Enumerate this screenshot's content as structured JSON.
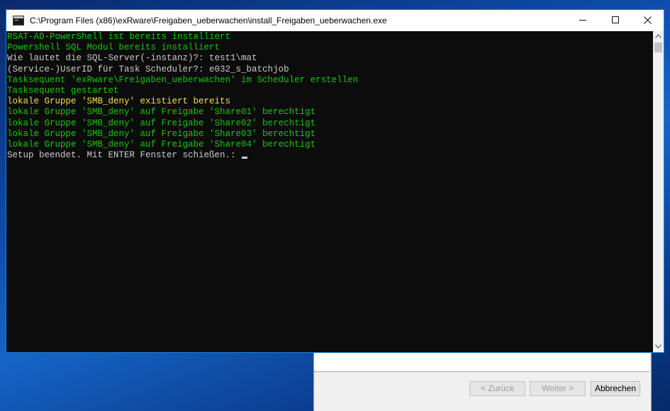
{
  "window": {
    "title": "C:\\Program Files (x86)\\exRware\\Freigaben_ueberwachen\\install_Freigaben_ueberwachen.exe",
    "icon": "console-icon",
    "controls": {
      "minimize": "minimize-icon",
      "maximize": "maximize-icon",
      "close": "close-icon"
    }
  },
  "console": {
    "colors": {
      "green": "#16c60c",
      "gray": "#cccccc",
      "yellow": "#f0e050",
      "background": "#0c0c0c"
    },
    "lines": [
      {
        "text": "RSAT-AD-PowerShell ist bereits installiert",
        "color": "green"
      },
      {
        "text": "Powershell SQL Modul bereits installiert",
        "color": "green"
      },
      {
        "text": "Wie lautet die SQL-Server(-instanz)?: test1\\mat",
        "color": "gray"
      },
      {
        "text": "(Service-)UserID für Task Scheduler?: e032_s_batchjob",
        "color": "gray"
      },
      {
        "text": "Tasksequent 'exRware\\Freigaben_ueberwachen' im Scheduler erstellen",
        "color": "green"
      },
      {
        "text": "Tasksequent gestartet",
        "color": "green"
      },
      {
        "text": "lokale Gruppe 'SMB_deny' existiert bereits",
        "color": "yellow"
      },
      {
        "text": "lokale Gruppe 'SMB_deny' auf Freigabe 'Share01' berechtigt",
        "color": "green"
      },
      {
        "text": "lokale Gruppe 'SMB_deny' auf Freigabe 'Share02' berechtigt",
        "color": "green"
      },
      {
        "text": "lokale Gruppe 'SMB_deny' auf Freigabe 'Share03' berechtigt",
        "color": "green"
      },
      {
        "text": "lokale Gruppe 'SMB_deny' auf Freigabe 'Share04' berechtigt",
        "color": "green"
      },
      {
        "text": "Setup beendet. Mit ENTER Fenster schießen.: ",
        "color": "gray",
        "cursor": true
      }
    ]
  },
  "wizard": {
    "back_label": "< Zurück",
    "next_label": "Weiter >",
    "cancel_label": "Abbrechen"
  }
}
